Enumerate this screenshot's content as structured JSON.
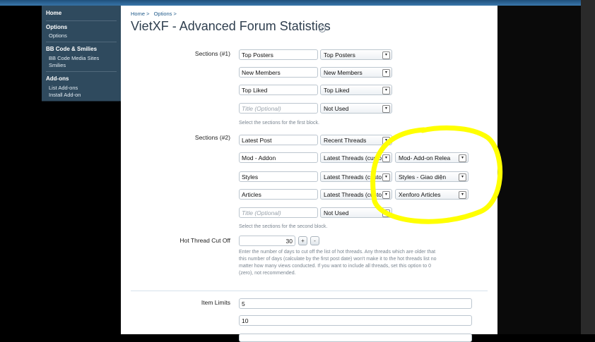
{
  "sidebar": {
    "home": "Home",
    "options_heading": "Options",
    "options_item": "Options",
    "bbcode_heading": "BB Code & Smilies",
    "bbcode_items": [
      "BB Code Media Sites",
      "Smilies"
    ],
    "addons_heading": "Add-ons",
    "addons_items": [
      "List Add-ons",
      "Install Add-on"
    ]
  },
  "breadcrumb": [
    "Home >",
    "Options >"
  ],
  "page_title": "VietXF - Advanced Forum Statistics",
  "sections1": {
    "label": "Sections (#1)",
    "rows": [
      {
        "title": "Top Posters",
        "select": "Top Posters"
      },
      {
        "title": "New Members",
        "select": "New Members"
      },
      {
        "title": "Top Liked",
        "select": "Top Liked"
      },
      {
        "title": "",
        "placeholder": "Title (Optional)",
        "select": "Not Used"
      }
    ],
    "hint": "Select the sections for the first block."
  },
  "sections2": {
    "label": "Sections (#2)",
    "rows": [
      {
        "title": "Latest Post",
        "select": "Recent Threads",
        "extra": ""
      },
      {
        "title": "Mod - Addon",
        "select": "Latest Threads (custo",
        "extra": "Mod- Add-on Relea"
      },
      {
        "title": "Styles",
        "select": "Latest Threads (custo",
        "extra": "Styles - Giao diện"
      },
      {
        "title": "Articles",
        "select": "Latest Threads (custo",
        "extra": "Xenforo Articles"
      },
      {
        "title": "",
        "placeholder": "Title (Optional)",
        "select": "Not Used",
        "extra": ""
      }
    ],
    "hint": "Select the sections for the second block."
  },
  "hot_thread": {
    "label": "Hot Thread Cut Off",
    "value": "30",
    "plus": "+",
    "minus": "-",
    "hint_lines": [
      "Enter the number of days to cut off the list of hot threads. Any threads which are older that",
      "this number of days (calculate by the first post date) won't make it to the hot threads list no",
      "matter how many views conducted. If you want to include all threads, set this option to 0",
      "(zero), not recommended."
    ]
  },
  "item_limits": {
    "label": "Item Limits",
    "values": [
      "5",
      "10"
    ]
  },
  "icons": {
    "dropdown": "chevron-down-icon",
    "title_menu": "menu-circle-icon"
  },
  "colors": {
    "highlight": "#ffff00",
    "sidebar_bg": "#2f4a5e",
    "link": "#1f5a8a"
  }
}
